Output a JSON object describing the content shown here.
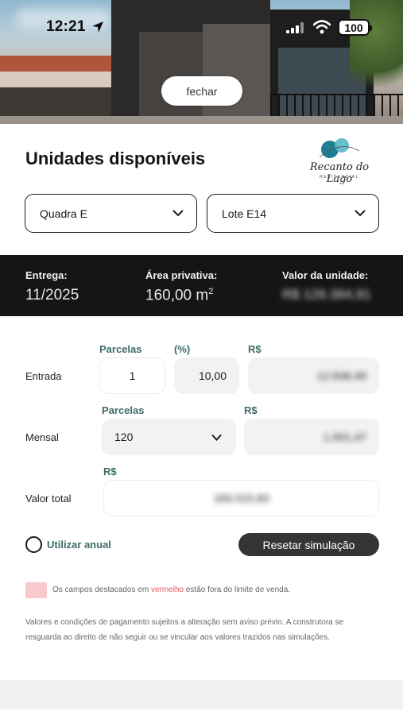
{
  "status_bar": {
    "time": "12:21",
    "battery": "100"
  },
  "hero": {
    "close_label": "fechar"
  },
  "header": {
    "title": "Unidades disponíveis",
    "logo_text": "Recanto do Lago",
    "logo_subtext": "RESIDENCIAL"
  },
  "selects": {
    "quadra": "Quadra E",
    "lote": "Lote E14"
  },
  "info": {
    "entrega_label": "Entrega:",
    "entrega_value": "11/2025",
    "area_label": "Área privativa:",
    "area_value": "160,00 m",
    "area_unit_sup": "2",
    "valor_label": "Valor da unidade:",
    "valor_value": "R$ 128.384,91"
  },
  "simulation": {
    "entrada": {
      "label": "Entrada",
      "parcelas_header": "Parcelas",
      "percent_header": "(%)",
      "rs_header": "R$",
      "parcelas": "1",
      "percent": "10,00",
      "value": "12.838,49"
    },
    "mensal": {
      "label": "Mensal",
      "parcelas_header": "Parcelas",
      "rs_header": "R$",
      "parcelas": "120",
      "value": "1.001,47"
    },
    "total": {
      "label": "Valor total",
      "rs_header": "R$",
      "value": "183.015,83"
    }
  },
  "controls": {
    "anual_label": "Utilizar anual",
    "reset_label": "Resetar simulação"
  },
  "notes": {
    "note1_pre": "Os campos destacados em ",
    "note1_red": "vermelho",
    "note1_post": " estão fora do limite de venda.",
    "note2": "Valores e condições de pagamento sujeitos a alteração sem aviso prévio. A construtora se resguarda ao direito de não seguir ou se vincular aos valores trazidos nas simulações."
  },
  "colors": {
    "accent_teal": "#3d6b68",
    "dark_band": "#151515",
    "reset_button": "#353535",
    "warning_swatch": "#f8c9cd",
    "warning_text": "#e65560"
  },
  "icons": [
    "location-arrow-icon",
    "cellular-signal-icon",
    "wifi-icon",
    "battery-icon",
    "chevron-down-icon",
    "logo-mark-icon"
  ]
}
